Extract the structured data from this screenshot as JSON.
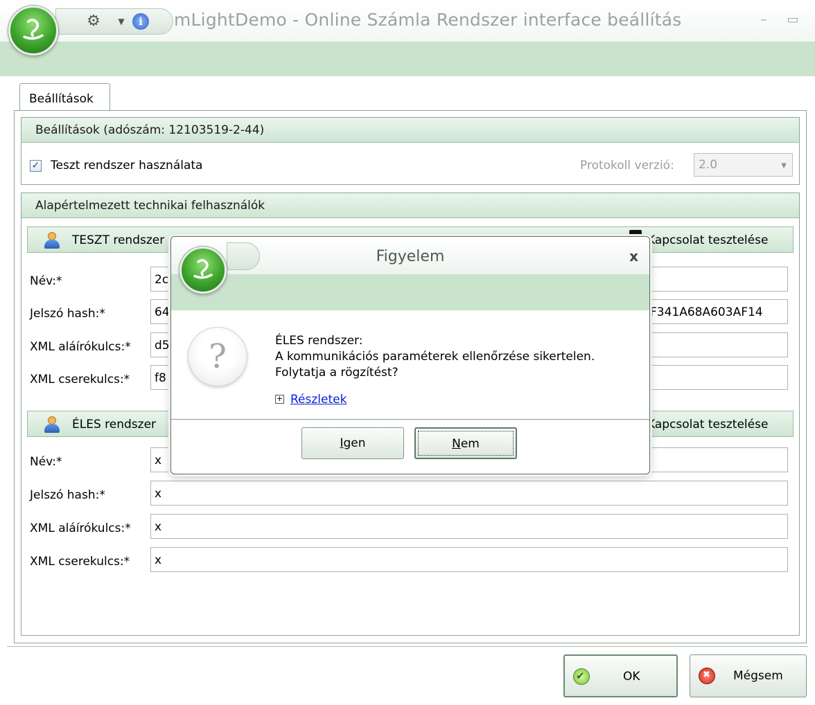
{
  "window": {
    "title": "mLightDemo - Online Számla Rendszer interface beállítás",
    "minimize": "–",
    "maximize": "▭"
  },
  "tabs": [
    {
      "label": "Beállítások"
    }
  ],
  "settings_group": {
    "header": "Beállítások (adószám: 12103519-2-44)",
    "test_checkbox_label": "Teszt rendszer használata",
    "test_checked": true,
    "protocol_label": "Protokoll verzió:",
    "protocol_value": "2.0"
  },
  "users_group": {
    "header": "Alapértelmezett technikai felhasználók",
    "test_system": {
      "header": "TESZT rendszer",
      "test_connection": "Kapcsolat tesztelése",
      "fields": [
        {
          "label": "Név:*",
          "value": "2c"
        },
        {
          "label": "Jelszó hash:*",
          "value": "64",
          "value_end": "F341A68A603AF14"
        },
        {
          "label": "XML aláírókulcs:*",
          "value": "d5"
        },
        {
          "label": "XML cserekulcs:*",
          "value": "f8"
        }
      ]
    },
    "live_system": {
      "header": "ÉLES rendszer",
      "test_connection": "Kapcsolat tesztelése",
      "fields": [
        {
          "label": "Név:*",
          "value": "x"
        },
        {
          "label": "Jelszó hash:*",
          "value": "x"
        },
        {
          "label": "XML aláírókulcs:*",
          "value": "x"
        },
        {
          "label": "XML cserekulcs:*",
          "value": "x"
        }
      ]
    }
  },
  "footer": {
    "ok_label": "OK",
    "cancel_label": "Mégsem"
  },
  "dialog": {
    "title": "Figyelem",
    "close": "x",
    "message_lines": [
      "ÉLES rendszer:",
      "A kommunikációs paraméterek ellenőrzése sikertelen.",
      "Folytatja a rögzítést?"
    ],
    "details_label": "Részletek",
    "yes_label_hotkey": "I",
    "yes_label_rest": "gen",
    "no_label_hotkey": "N",
    "no_label_rest": "em"
  },
  "colors": {
    "ribbon": "#c9e3cc",
    "header_gradient_top": "#eaf5ec",
    "header_gradient_bottom": "#cfe6d3",
    "orb_green": "#3da32d",
    "link_blue": "#0a1fd6"
  },
  "icons": {
    "app_orb": "app-orb-icon",
    "gear": "gear-icon",
    "info": "info-icon",
    "user": "user-icon",
    "question": "question-icon",
    "ok": "check-icon",
    "cancel": "cancel-icon",
    "expand": "plus-box-icon"
  }
}
